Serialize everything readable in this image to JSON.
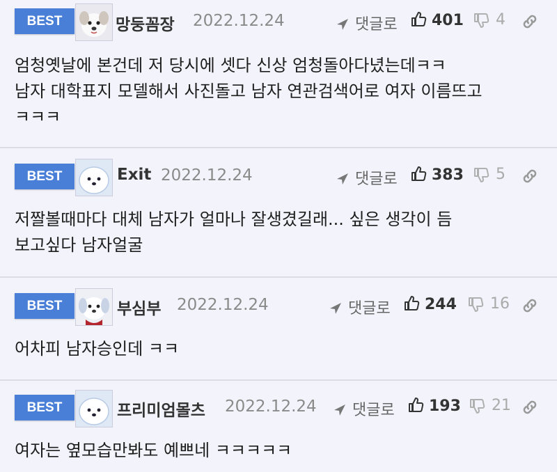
{
  "comments": [
    {
      "badge": "BEST",
      "nickname": "망둥꼼장",
      "date": "2022.12.24",
      "reply_label": "댓글로",
      "likes": "401",
      "dislikes": "4",
      "text": "엄청옛날에 본건데 저 당시에 셋다 신상 엄청돌아다녔는데ㅋㅋ\n남자 대학표지 모델해서 사진돌고 남자 연관검색어로 여자 이름뜨고\nㅋㅋㅋ"
    },
    {
      "badge": "BEST",
      "nickname": "Exit",
      "date": "2022.12.24",
      "reply_label": "댓글로",
      "likes": "383",
      "dislikes": "5",
      "text": "저짤볼때마다 대체 남자가 얼마나 잘생겼길래... 싶은 생각이 듬\n보고싶다 남자얼굴"
    },
    {
      "badge": "BEST",
      "nickname": "부심부",
      "date": "2022.12.24",
      "reply_label": "댓글로",
      "likes": "244",
      "dislikes": "16",
      "text": "어차피 남자승인데 ㅋㅋ"
    },
    {
      "badge": "BEST",
      "nickname": "프리미엄몰츠",
      "date": "2022.12.24",
      "reply_label": "댓글로",
      "likes": "193",
      "dislikes": "21",
      "text": "여자는 옆모습만봐도 예쁘네 ㅋㅋㅋㅋㅋ"
    }
  ],
  "icons": {
    "reply": "reply-arrow-icon",
    "like": "thumbs-up-icon",
    "dislike": "thumbs-down-icon",
    "link": "link-icon"
  },
  "colors": {
    "background": "#f3f3fb",
    "badge": "#4a7fd8",
    "divider": "#dcdce4"
  }
}
